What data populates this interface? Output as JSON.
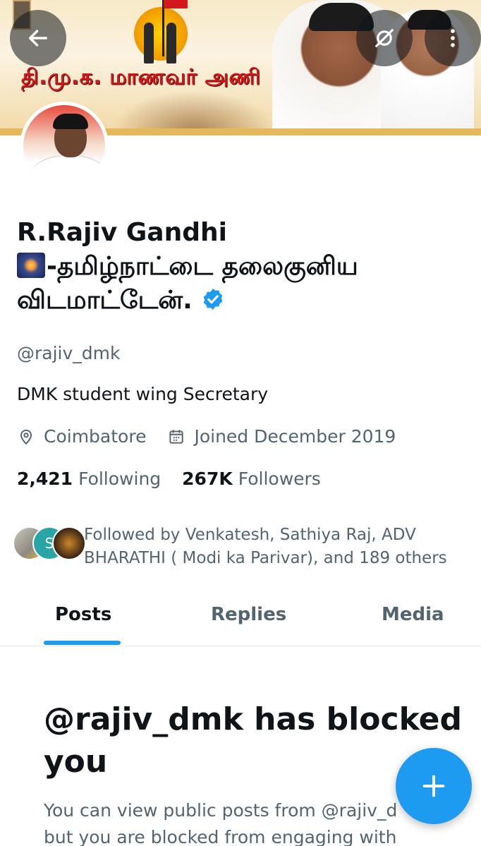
{
  "header": {
    "banner_title": "தி.மு.க. மாணவர் அணி",
    "back_label": "Back",
    "more_label": "More"
  },
  "profile": {
    "name_line1": "R.Rajiv Gandhi",
    "name_line2": "-தமிழ்நாட்டை தலைகுனிய",
    "name_line3": "விடமாட்டேன்.",
    "handle": "@rajiv_dmk",
    "bio": "DMK student wing Secretary",
    "location": "Coimbatore",
    "joined": "Joined December 2019",
    "following_count": "2,421",
    "following_label": "Following",
    "followers_count": "267K",
    "followers_label": "Followers",
    "followed_by_line1": "Followed by Venkatesh, Sathiya Raj, ADV",
    "followed_by_line2": "BHARATHI ( Modi ka Parivar), and 189 others",
    "follower_avatar_initial": "S"
  },
  "tabs": [
    {
      "label": "Posts",
      "active": true
    },
    {
      "label": "Replies",
      "active": false
    },
    {
      "label": "Media",
      "active": false
    }
  ],
  "blocked": {
    "title_line1": "@rajiv_dmk has blocked",
    "title_line2": "you",
    "desc_line1": "You can view public posts from @rajiv_d",
    "desc_line2": "but you are blocked from engaging with"
  },
  "colors": {
    "accent": "#1d9bf0",
    "text_primary": "#0f1419",
    "text_secondary": "#536471",
    "banner_red": "#d11919"
  },
  "icons": {
    "back": "arrow-left-icon",
    "no_notify": "notification-off-icon",
    "more": "more-vertical-icon",
    "location": "location-pin-icon",
    "calendar": "calendar-icon",
    "verified": "verified-badge-icon",
    "compose": "plus-icon"
  }
}
